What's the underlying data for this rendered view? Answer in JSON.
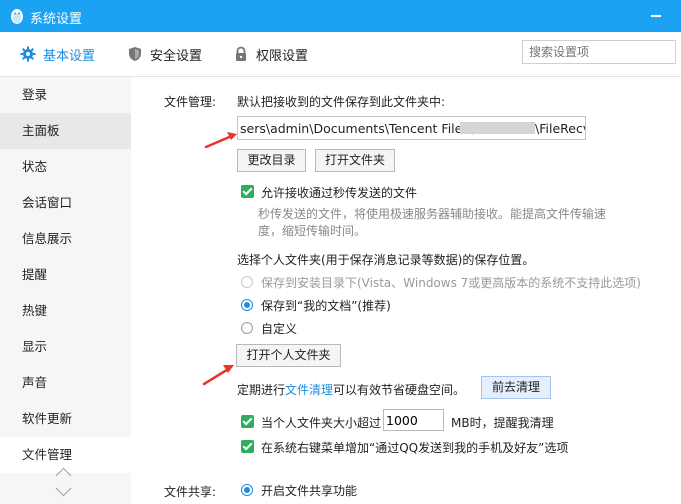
{
  "window": {
    "title": "系统设置"
  },
  "colors": {
    "titlebar": "#1ba2f2",
    "accent": "#1a8ee0",
    "check": "#2dae5f",
    "arrow": "#e8342b"
  },
  "tabs": [
    {
      "label": "基本设置",
      "icon": "gear-icon",
      "active": true
    },
    {
      "label": "安全设置",
      "icon": "shield-icon",
      "active": false
    },
    {
      "label": "权限设置",
      "icon": "lock-icon",
      "active": false
    }
  ],
  "search": {
    "placeholder": "搜索设置项",
    "value": ""
  },
  "sidebar": {
    "items": [
      {
        "label": "登录"
      },
      {
        "label": "主面板"
      },
      {
        "label": "状态"
      },
      {
        "label": "会话窗口"
      },
      {
        "label": "信息展示"
      },
      {
        "label": "提醒"
      },
      {
        "label": "热键"
      },
      {
        "label": "显示"
      },
      {
        "label": "声音"
      },
      {
        "label": "软件更新"
      },
      {
        "label": "文件管理"
      }
    ]
  },
  "file_mgmt": {
    "section_label": "文件管理:",
    "save_desc": "默认把接收到的文件保存到此文件夹中:",
    "path_start": "sers\\admin\\Documents\\Tencent Files\\",
    "path_end": "\\FileRecv\\",
    "change_dir_btn": "更改目录",
    "open_folder_btn": "打开文件夹",
    "allow_flash_label": "允许接收通过秒传发送的文件",
    "allow_flash_desc_line1": "秒传发送的文件，将使用极速服务器辅助接收。能提高文件传输速",
    "allow_flash_desc_line2": "度，缩短传输时间。",
    "personal_folder_desc": "选择个人文件夹(用于保存消息记录等数据)的保存位置。",
    "radio_install_dir": "保存到安装目录下(Vista、Windows 7或更高版本的系统不支持此选项)",
    "radio_my_docs": "保存到“我的文档”(推荐)",
    "radio_custom": "自定义",
    "open_personal_btn": "打开个人文件夹",
    "cleanup_prefix": "定期进行",
    "cleanup_link": "文件清理",
    "cleanup_suffix": "可以有效节省硬盘空间。",
    "go_clean_btn": "前去清理",
    "size_limit_label": "当个人文件夹大小超过",
    "size_limit_value": "1000",
    "size_limit_suffix": "MB时，提醒我清理",
    "context_menu_label": "在系统右键菜单增加“通过QQ发送到我的手机及好友”选项"
  },
  "file_share": {
    "section_label": "文件共享:",
    "enable_label": "开启文件共享功能"
  }
}
